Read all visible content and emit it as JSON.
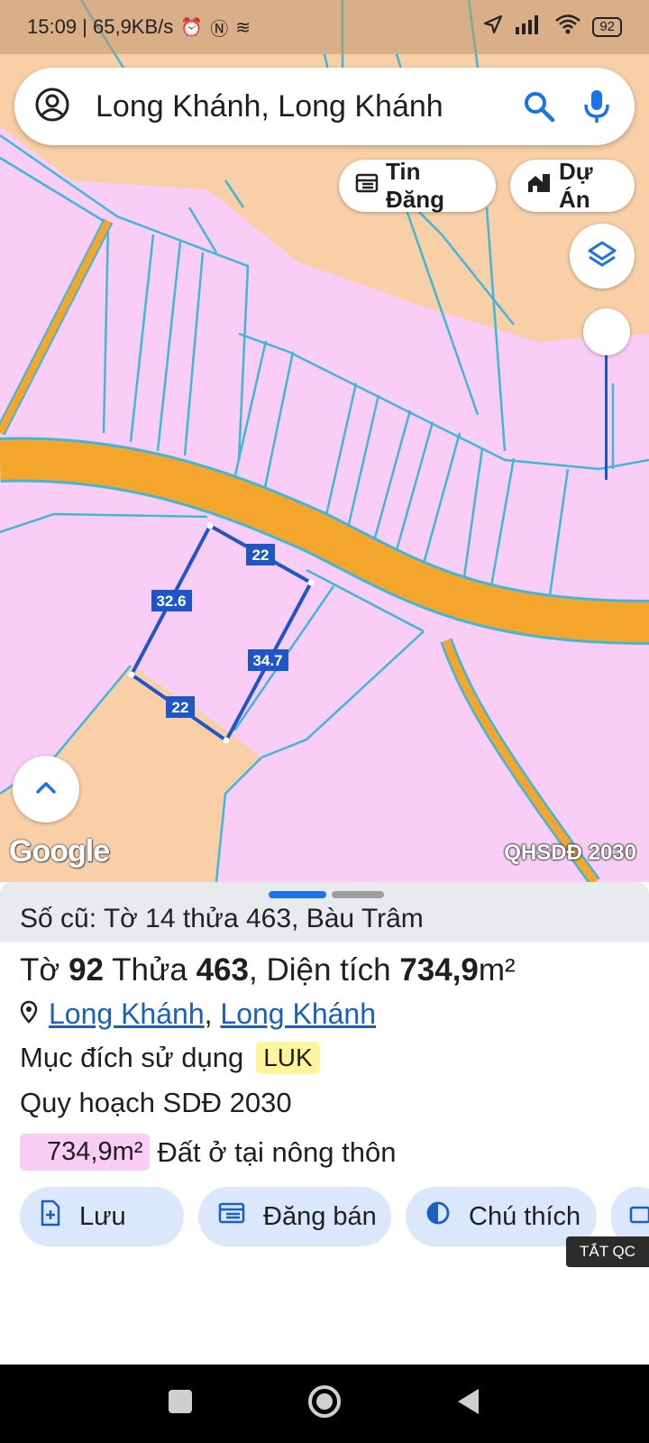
{
  "status_bar": {
    "time_speed": "15:09 | 65,9KB/s",
    "battery": "92",
    "icons": [
      "alarm-icon",
      "nfc-icon",
      "app-icon",
      "location-arrow-icon",
      "signal-icon",
      "wifi-icon",
      "battery-icon"
    ]
  },
  "search": {
    "text": "Long Khánh, Long Khánh",
    "icons": [
      "account-icon",
      "search-icon",
      "mic-icon"
    ]
  },
  "chips": {
    "tin_dang": "Tin Đăng",
    "du_an": "Dự Án"
  },
  "map": {
    "google_logo": "Google",
    "watermark": "QHSDĐ 2030",
    "edge_labels": [
      "22",
      "32.6",
      "34.7",
      "22"
    ],
    "colors": {
      "residential": "#f9cdf5",
      "agricultural": "#f8cfa6",
      "road": "#f4a52c",
      "parcel_line": "#3fb8d8",
      "selection": "#1c56c9"
    }
  },
  "sheet": {
    "old_info": "Số cũ: Tờ 14 thửa 463, Bàu Trâm",
    "parcel": {
      "to_label": "Tờ",
      "to_value": "92",
      "thua_label": "Thửa",
      "thua_value": "463",
      "area_label": ", Diện tích",
      "area_value": "734,9",
      "area_unit": "m²"
    },
    "location": {
      "link1": "Long Khánh",
      "separator": ",",
      "link2": "Long Khánh"
    },
    "purpose_label": "Mục đích sử dụng",
    "purpose_code": "LUK",
    "plan_label": "Quy hoạch SDĐ 2030",
    "area_chip": "734,9m²",
    "area_desc": "Đất ở tại nông thôn",
    "actions": {
      "save": "Lưu",
      "post_sale": "Đăng bán",
      "legend": "Chú thích"
    },
    "ad_tag": "TẮT QC"
  },
  "nav": {
    "icons": [
      "recents-icon",
      "home-icon",
      "back-icon"
    ]
  }
}
